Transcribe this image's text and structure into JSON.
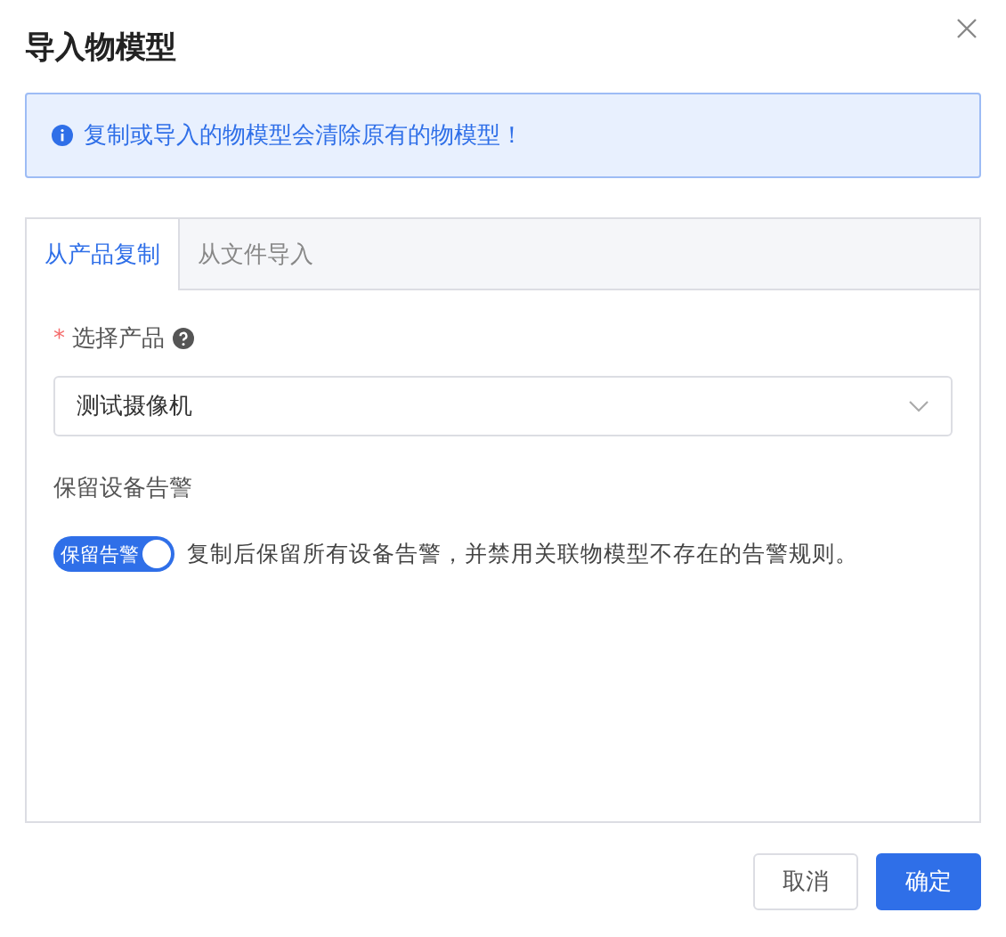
{
  "dialog": {
    "title": "导入物模型"
  },
  "alert": {
    "text": "复制或导入的物模型会清除原有的物模型！"
  },
  "tabs": [
    {
      "label": "从产品复制",
      "selected": true
    },
    {
      "label": "从文件导入",
      "selected": false
    }
  ],
  "product_field": {
    "required_mark": "*",
    "label": "选择产品",
    "value": "测试摄像机"
  },
  "alarm_section": {
    "label": "保留设备告警",
    "switch": {
      "label": "保留告警",
      "on": true
    },
    "description": "复制后保留所有设备告警，并禁用关联物模型不存在的告警规则。"
  },
  "buttons": [
    {
      "label": "取消",
      "kind": "default"
    },
    {
      "label": "确定",
      "kind": "primary"
    }
  ]
}
